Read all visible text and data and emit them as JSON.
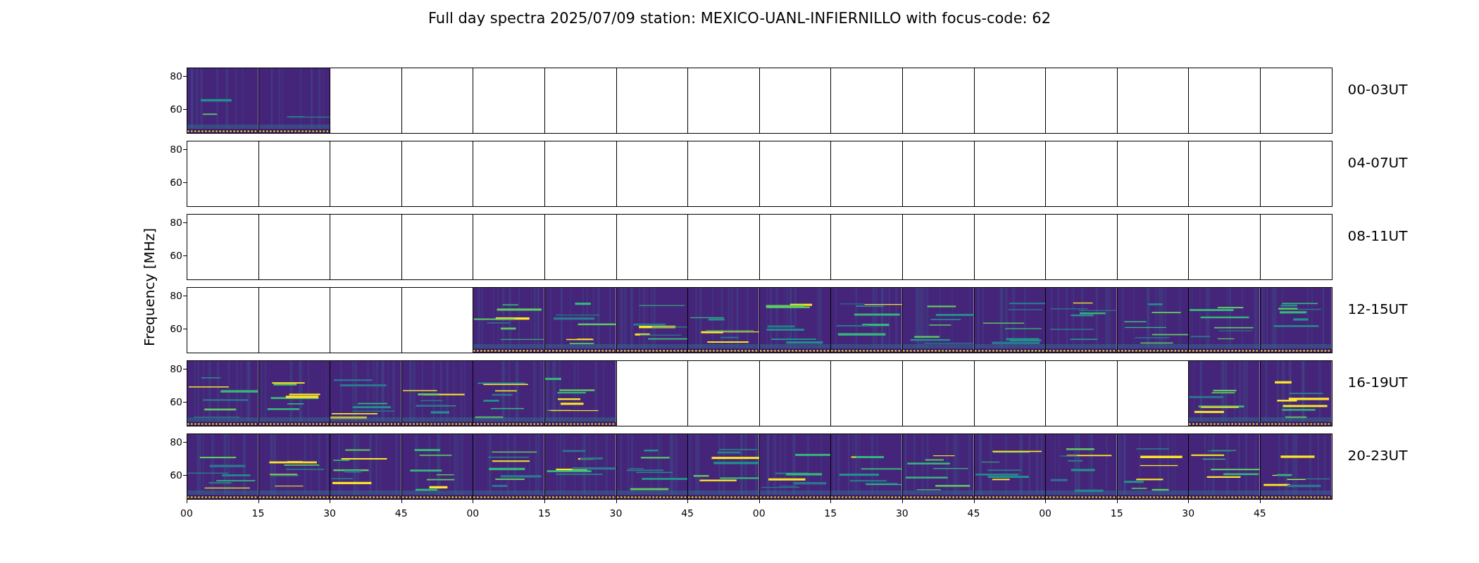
{
  "title": "Full day spectra 2025/07/09 station: MEXICO-UANL-INFIERNILLO with focus-code: 62",
  "ylabel": "Frequency [MHz]",
  "rows": [
    {
      "label": "00-03UT",
      "yticks": [
        "80",
        "60"
      ],
      "panels": [
        {
          "data": true
        },
        {
          "data": true
        },
        {
          "data": false
        },
        {
          "data": false
        },
        {
          "data": false
        },
        {
          "data": false
        },
        {
          "data": false
        },
        {
          "data": false
        },
        {
          "data": false
        },
        {
          "data": false
        },
        {
          "data": false
        },
        {
          "data": false
        },
        {
          "data": false
        },
        {
          "data": false
        },
        {
          "data": false
        },
        {
          "data": false
        }
      ]
    },
    {
      "label": "04-07UT",
      "yticks": [
        "80",
        "60"
      ],
      "panels": [
        {
          "data": false
        },
        {
          "data": false
        },
        {
          "data": false
        },
        {
          "data": false
        },
        {
          "data": false
        },
        {
          "data": false
        },
        {
          "data": false
        },
        {
          "data": false
        },
        {
          "data": false
        },
        {
          "data": false
        },
        {
          "data": false
        },
        {
          "data": false
        },
        {
          "data": false
        },
        {
          "data": false
        },
        {
          "data": false
        },
        {
          "data": false
        }
      ]
    },
    {
      "label": "08-11UT",
      "yticks": [
        "80",
        "60"
      ],
      "panels": [
        {
          "data": false
        },
        {
          "data": false
        },
        {
          "data": false
        },
        {
          "data": false
        },
        {
          "data": false
        },
        {
          "data": false
        },
        {
          "data": false
        },
        {
          "data": false
        },
        {
          "data": false
        },
        {
          "data": false
        },
        {
          "data": false
        },
        {
          "data": false
        },
        {
          "data": false
        },
        {
          "data": false
        },
        {
          "data": false
        },
        {
          "data": false
        }
      ]
    },
    {
      "label": "12-15UT",
      "yticks": [
        "80",
        "60"
      ],
      "panels": [
        {
          "data": false
        },
        {
          "data": false
        },
        {
          "data": false
        },
        {
          "data": false
        },
        {
          "data": true
        },
        {
          "data": true
        },
        {
          "data": true
        },
        {
          "data": true
        },
        {
          "data": true
        },
        {
          "data": true
        },
        {
          "data": true
        },
        {
          "data": true
        },
        {
          "data": true
        },
        {
          "data": true
        },
        {
          "data": true
        },
        {
          "data": true
        }
      ]
    },
    {
      "label": "16-19UT",
      "yticks": [
        "80",
        "60"
      ],
      "panels": [
        {
          "data": true
        },
        {
          "data": true
        },
        {
          "data": true
        },
        {
          "data": true
        },
        {
          "data": true
        },
        {
          "data": true
        },
        {
          "data": false
        },
        {
          "data": false
        },
        {
          "data": false
        },
        {
          "data": false
        },
        {
          "data": false
        },
        {
          "data": false
        },
        {
          "data": false
        },
        {
          "data": false
        },
        {
          "data": true
        },
        {
          "data": true
        }
      ]
    },
    {
      "label": "20-23UT",
      "yticks": [
        "80",
        "60"
      ],
      "panels": [
        {
          "data": true
        },
        {
          "data": true
        },
        {
          "data": true
        },
        {
          "data": true
        },
        {
          "data": true
        },
        {
          "data": true
        },
        {
          "data": true
        },
        {
          "data": true
        },
        {
          "data": true
        },
        {
          "data": true
        },
        {
          "data": true
        },
        {
          "data": true
        },
        {
          "data": true
        },
        {
          "data": true
        },
        {
          "data": true
        },
        {
          "data": true
        }
      ]
    }
  ],
  "xticks": [
    "00",
    "15",
    "30",
    "45",
    "00",
    "15",
    "30",
    "45",
    "00",
    "15",
    "30",
    "45",
    "00",
    "15",
    "30",
    "45"
  ]
}
